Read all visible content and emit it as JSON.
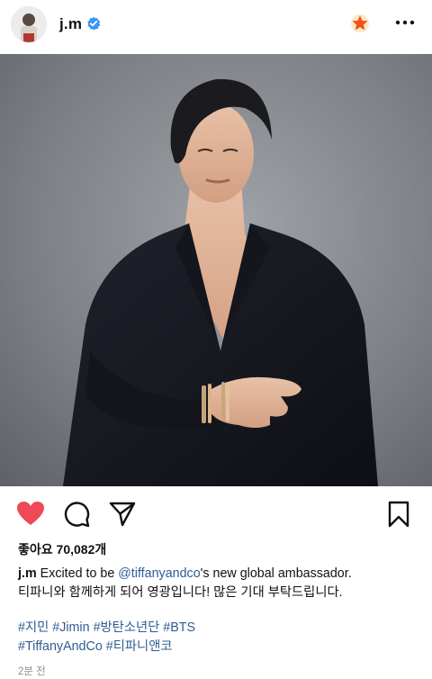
{
  "post": {
    "username": "j.m",
    "likes_text": "좋아요 70,082개",
    "caption_username": "j.m",
    "caption_pre": "Excited to be ",
    "caption_mention": "@tiffanyandco",
    "caption_post": "'s new global ambassador.",
    "caption_line2": "티파니와 함께하게 되어 영광입니다! 많은 기대 부탁드립니다.",
    "hashtags_line1": [
      "#지민",
      "#Jimin",
      "#방탄소년단",
      "#BTS"
    ],
    "hashtags_line2": [
      "#TiffanyAndCo",
      "#티파니앤코"
    ],
    "time": "2분 전"
  },
  "colors": {
    "like_red": "#ed4956",
    "favorite_orange": "#f5a623",
    "verified_blue": "#3897f0",
    "hashtag_blue": "#2f5c94"
  },
  "icons": {
    "header": [
      "verified-badge-icon",
      "favorite-star-icon",
      "more-options-icon"
    ],
    "actions": [
      "heart-icon",
      "comment-icon",
      "share-icon",
      "bookmark-icon"
    ]
  }
}
